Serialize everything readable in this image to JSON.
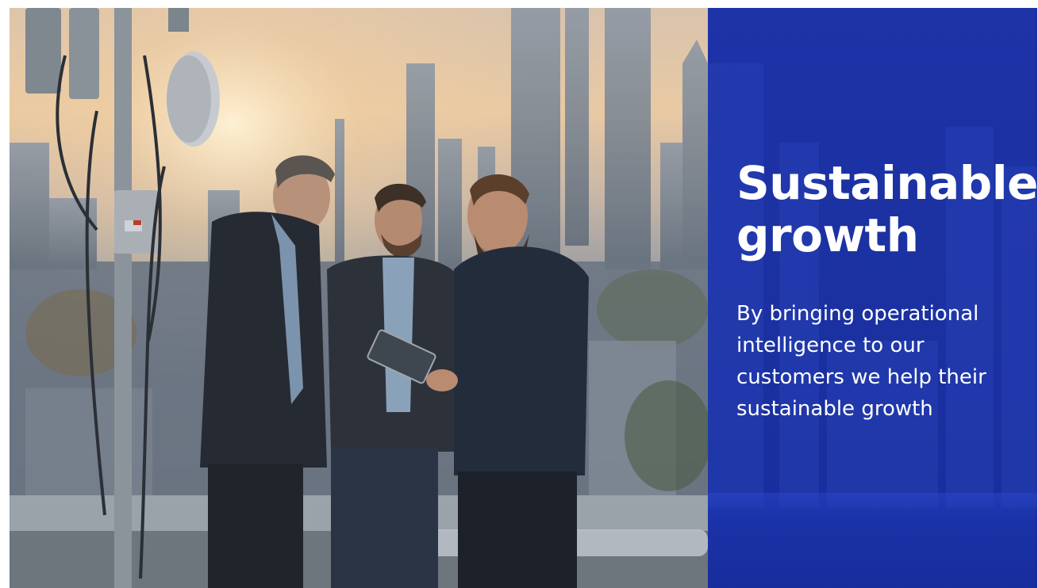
{
  "slide": {
    "title_line_1": "Sustainable",
    "title_line_2": "growth",
    "body": "By bringing operational intelligence to our customers we help their sustainable growth"
  },
  "image": {
    "subject": "three men on a rooftop next to a telecom antenna mast, looking at a tablet, city skyline at dusk"
  },
  "colors": {
    "panel_blue": "#1c32aa",
    "text": "#ffffff"
  }
}
